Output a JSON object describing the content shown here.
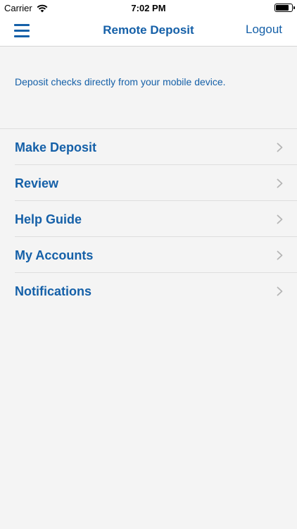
{
  "status_bar": {
    "carrier": "Carrier",
    "time": "7:02 PM",
    "battery_level": 0.9
  },
  "nav": {
    "title": "Remote Deposit",
    "logout_label": "Logout",
    "menu_icon": "hamburger-menu-icon"
  },
  "intro_text": "Deposit checks directly from your mobile device.",
  "menu": {
    "items": [
      {
        "label": "Make Deposit"
      },
      {
        "label": "Review"
      },
      {
        "label": "Help Guide"
      },
      {
        "label": "My Accounts"
      },
      {
        "label": "Notifications"
      }
    ],
    "chevron_icon": "chevron-right-icon"
  },
  "colors": {
    "accent": "#1560a8",
    "background": "#f4f4f4",
    "bar": "#ffffff",
    "separator": "#dedede"
  }
}
